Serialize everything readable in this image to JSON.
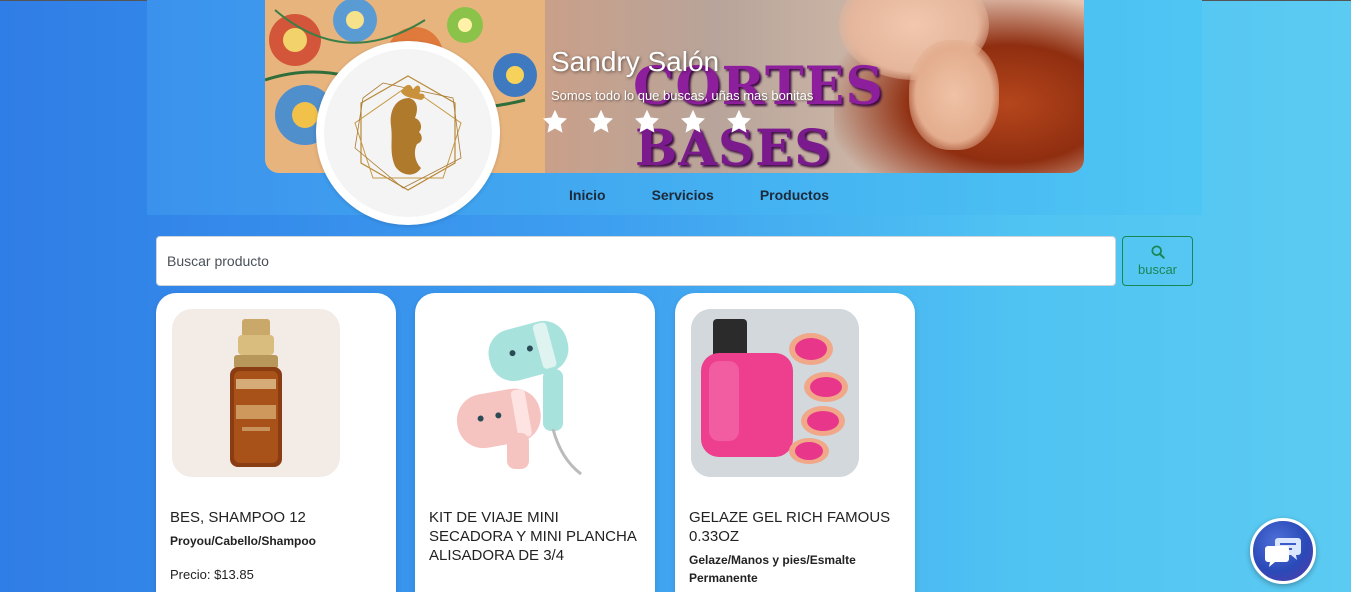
{
  "banner": {
    "salon_name": "Sandry Salón",
    "tagline": "Somos todo lo que buscas, uñas mas bonitas",
    "overlay_word_1": "CORTES",
    "overlay_word_2": "BASES",
    "rating_stars": 5
  },
  "nav": {
    "items": [
      {
        "label": "Inicio"
      },
      {
        "label": "Servicios"
      },
      {
        "label": "Productos"
      }
    ]
  },
  "search": {
    "placeholder": "Buscar producto",
    "button_label": "buscar",
    "button_icon": "search-icon"
  },
  "products": [
    {
      "title": "BES, SHAMPOO 12",
      "category": "Proyou/Cabello/Shampoo",
      "price": "Precio: $13.85",
      "image": "serum-bottle"
    },
    {
      "title": "KIT DE VIAJE MINI SECADORA Y MINI PLANCHA ALISADORA DE 3/4",
      "category": "",
      "price": "",
      "image": "mini-hair-dryers"
    },
    {
      "title": "GELAZE GEL RICH FAMOUS 0.33OZ",
      "category": "Gelaze/Manos y pies/Esmalte Permanente",
      "price": "",
      "image": "pink-nail-polish"
    }
  ],
  "colors": {
    "accent_green": "#198754",
    "brand_purple": "#8e1f9c",
    "page_blue": "#3e9ff0"
  },
  "chat": {
    "icon": "chat-bubbles-icon"
  }
}
